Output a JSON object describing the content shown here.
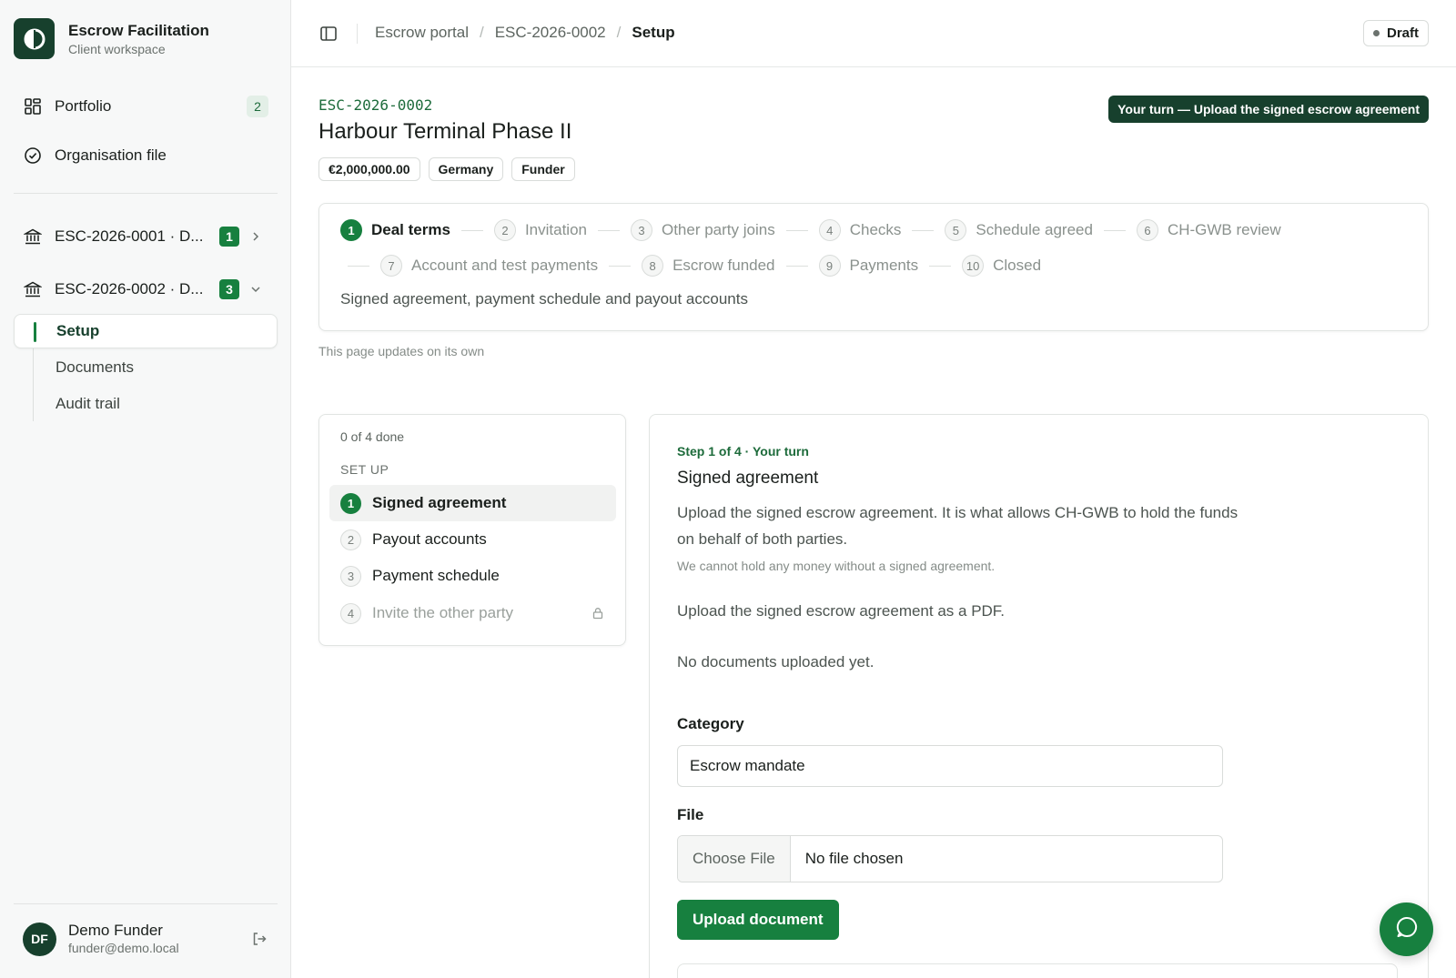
{
  "brand": {
    "title": "Escrow Facilitation",
    "subtitle": "Client workspace",
    "logo_icon": "escrow-logo-icon"
  },
  "nav": {
    "portfolio": {
      "label": "Portfolio",
      "count": "2",
      "icon": "grid-icon"
    },
    "organisation_file": {
      "label": "Organisation file",
      "icon": "check-circle-icon"
    }
  },
  "deals": [
    {
      "label": "ESC-2026-0001 · D...",
      "badge": "1",
      "expanded": false,
      "icon": "bank-icon"
    },
    {
      "label": "ESC-2026-0002 · D...",
      "badge": "3",
      "expanded": true,
      "icon": "bank-icon"
    }
  ],
  "subnav": {
    "setup": "Setup",
    "documents": "Documents",
    "audit_trail": "Audit trail"
  },
  "user": {
    "initials": "DF",
    "name": "Demo Funder",
    "email": "funder@demo.local"
  },
  "topbar": {
    "breadcrumbs": [
      "Escrow portal",
      "ESC-2026-0002",
      "Setup"
    ],
    "separator": "/",
    "status": "Draft"
  },
  "deal": {
    "ref": "ESC-2026-0002",
    "title": "Harbour Terminal Phase II",
    "tags": [
      "€2,000,000.00",
      "Germany",
      "Funder"
    ],
    "turn_banner": "Your turn — Upload the signed escrow agreement"
  },
  "stepper": {
    "steps": [
      {
        "num": "1",
        "label": "Deal terms",
        "active": true
      },
      {
        "num": "2",
        "label": "Invitation"
      },
      {
        "num": "3",
        "label": "Other party joins"
      },
      {
        "num": "4",
        "label": "Checks"
      },
      {
        "num": "5",
        "label": "Schedule agreed"
      },
      {
        "num": "6",
        "label": "CH-GWB review"
      },
      {
        "num": "7",
        "label": "Account and test payments"
      },
      {
        "num": "8",
        "label": "Escrow funded"
      },
      {
        "num": "9",
        "label": "Payments"
      },
      {
        "num": "10",
        "label": "Closed"
      }
    ],
    "description": "Signed agreement, payment schedule and payout accounts"
  },
  "updates_note": "This page updates on its own",
  "tasks": {
    "progress": "0 of 4 done",
    "section": "SET UP",
    "items": [
      {
        "num": "1",
        "label": "Signed agreement",
        "state": "active"
      },
      {
        "num": "2",
        "label": "Payout accounts",
        "state": "open"
      },
      {
        "num": "3",
        "label": "Payment schedule",
        "state": "open"
      },
      {
        "num": "4",
        "label": "Invite the other party",
        "state": "locked"
      }
    ]
  },
  "detail": {
    "eyebrow": "Step 1 of 4 · Your turn",
    "title": "Signed agreement",
    "description": "Upload the signed escrow agreement. It is what allows CH-GWB to hold the funds on behalf of both parties.",
    "note": "We cannot hold any money without a signed agreement.",
    "instruction": "Upload the signed escrow agreement as a PDF.",
    "empty_state": "No documents uploaded yet.",
    "category_label": "Category",
    "category_value": "Escrow mandate",
    "file_label": "File",
    "choose_file": "Choose File",
    "file_status": "No file chosen",
    "upload_button": "Upload document"
  },
  "colors": {
    "accent": "#17803f",
    "brand_dark": "#17402d",
    "accent_text": "#1d6b3b"
  }
}
